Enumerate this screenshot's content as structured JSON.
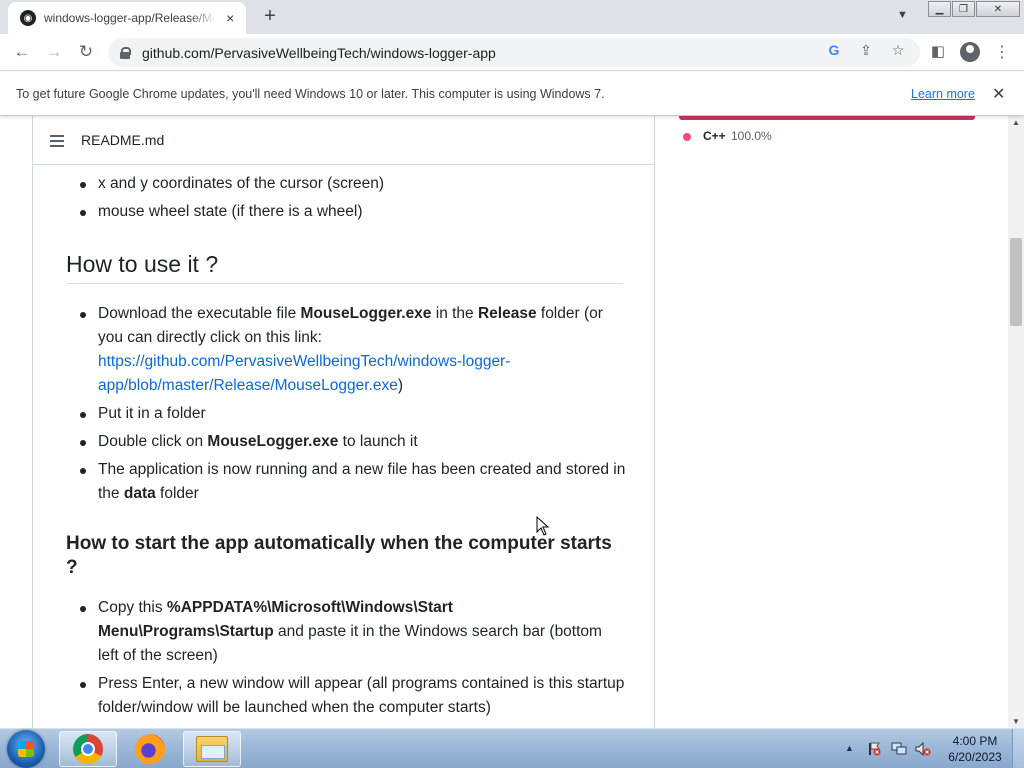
{
  "browser": {
    "tab_title": "windows-logger-app/Release/MouseLogger.exe",
    "tab_close": "×",
    "new_tab": "+",
    "url": "github.com/PervasiveWellbeingTech/windows-logger-app",
    "icons": [
      "back-icon",
      "forward-icon",
      "reload-icon",
      "lock-icon",
      "google-lens-icon",
      "share-icon",
      "star-icon",
      "side-panel-icon",
      "profile-icon",
      "menu-icon"
    ]
  },
  "infobar": {
    "message": "To get future Google Chrome updates, you'll need Windows 10 or later. This computer is using Windows 7.",
    "link": "Learn more"
  },
  "readme": {
    "file_name": "README.md",
    "list_top": [
      "x and y coordinates of the cursor (screen)",
      "mouse wheel state (if there is a wheel)"
    ],
    "h_use": "How to use it ?",
    "use_steps": {
      "s1_a": "Download the executable file ",
      "s1_b": "MouseLogger.exe",
      "s1_c": " in the ",
      "s1_d": "Release",
      "s1_e": " folder (or you can directly click on this link: ",
      "s1_link": "https://github.com/PervasiveWellbeingTech/windows-logger-app/blob/master/Release/MouseLogger.exe",
      "s1_f": ")",
      "s2": "Put it in a folder",
      "s3_a": "Double click on ",
      "s3_b": "MouseLogger.exe",
      "s3_c": " to launch it",
      "s4_a": "The application is now running and a new file has been created and stored in the ",
      "s4_b": "data",
      "s4_c": " folder"
    },
    "h_start": "How to start the app automatically when the computer starts ?",
    "start_steps": {
      "s1_a": "Copy this ",
      "s1_b": "%APPDATA%\\Microsoft\\Windows\\Start Menu\\Programs\\Startup",
      "s1_c": " and paste it in the Windows search bar (bottom left of the screen)",
      "s2": "Press Enter, a new window will appear (all programs contained is this startup folder/window will be launched when the computer starts)"
    }
  },
  "sidebar": {
    "language": "C++",
    "percent": "100.0%",
    "lang_color": "#f34b7d"
  },
  "taskbar": {
    "apps": [
      "Google Chrome",
      "Firefox",
      "Windows Explorer"
    ],
    "time": "4:00 PM",
    "date": "6/20/2023"
  }
}
